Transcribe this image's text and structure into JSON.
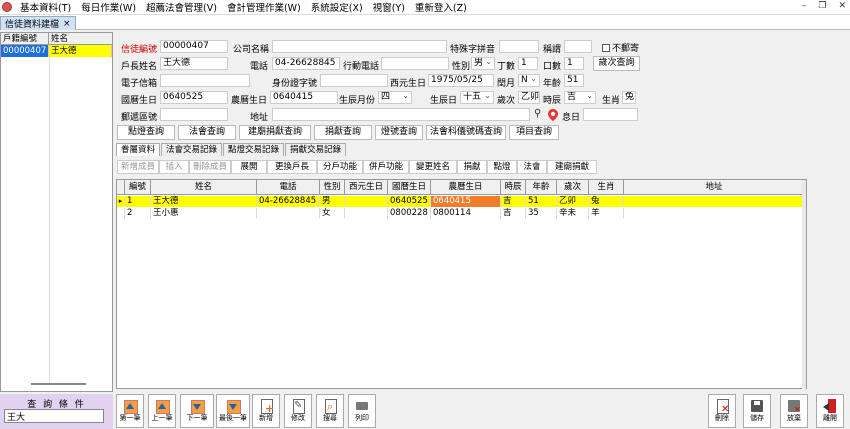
{
  "menu": {
    "items": [
      "基本資料(T)",
      "每日作業(W)",
      "超薦法會管理(V)",
      "會計管理作業(W)",
      "系統設定(X)",
      "視窗(Y)",
      "重新登入(Z)"
    ],
    "minimize": "–",
    "restore": "❐",
    "close": "✕"
  },
  "doc_tab": {
    "label": "信徒資料建檔",
    "close": "×"
  },
  "left_table": {
    "headers": [
      "戶籍編號",
      "姓名"
    ],
    "rows": [
      {
        "id": "00000407",
        "name": "王大德"
      }
    ]
  },
  "query": {
    "label": "查 詢 條 件",
    "value": "王大"
  },
  "form": {
    "member_no_label": "信徒編號",
    "member_no": "00000407",
    "company_label": "公司名稱",
    "company": "",
    "pinyin_label": "特殊字拼音",
    "pinyin": "",
    "title_label": "稱謂",
    "title": "",
    "no_mail_label": "不郵寄",
    "head_label": "戶長姓名",
    "head": "王大德",
    "phone_label": "電話",
    "phone": "04-26628845",
    "mobile_label": "行動電話",
    "mobile": "",
    "gender_label": "性別",
    "gender": "男",
    "ding_label": "丁數",
    "ding": "1",
    "kou_label": "口數",
    "kou": "1",
    "annual_btn": "歲次查詢",
    "email_label": "電子信箱",
    "email": "",
    "idno_label": "身份證字號",
    "idno": "",
    "west_birth_label": "西元生日",
    "west_birth": "1975/05/25",
    "leap_label": "閏月",
    "leap": "N",
    "age_label": "年齡",
    "age": "51",
    "roc_birth_label": "國曆生日",
    "roc_birth": "0640525",
    "lunar_birth_label": "農曆生日",
    "lunar_birth": "0640415",
    "birth_month_label": "生辰月份",
    "birth_month": "四",
    "birth_day_label": "生辰日",
    "birth_day": "十五",
    "annual_label": "歲次",
    "annual": "乙卯",
    "hour_label": "時辰",
    "hour": "吉",
    "zodiac_label": "生肖",
    "zodiac": "兔",
    "zip_label": "郵遞區號",
    "zip": "",
    "addr_label": "地址",
    "addr": "",
    "search_icon": "⚲",
    "remark_label": "息日",
    "remark": ""
  },
  "query_buttons": [
    "點燈查詢",
    "法會查詢",
    "建廟捐獻查詢",
    "捐獻查詢",
    "燈號查詢",
    "法會科儀號碼查詢",
    "項目查詢"
  ],
  "subtabs": [
    "眷屬資料",
    "法會交易記錄",
    "點燈交易記錄",
    "捐獻交易記錄"
  ],
  "toolbar2": [
    {
      "label": "新增成員",
      "disabled": true
    },
    {
      "label": "插入",
      "disabled": true
    },
    {
      "label": "刪除成員",
      "disabled": true
    },
    {
      "label": "展開",
      "disabled": false
    },
    {
      "label": "更換戶長",
      "disabled": false
    },
    {
      "label": "分戶功能",
      "disabled": false
    },
    {
      "label": "併戶功能",
      "disabled": false
    },
    {
      "label": "變更姓名",
      "disabled": false
    },
    {
      "label": "捐獻",
      "disabled": false
    },
    {
      "label": "點燈",
      "disabled": false
    },
    {
      "label": "法會",
      "disabled": false
    },
    {
      "label": "建廟捐獻",
      "disabled": false
    }
  ],
  "grid": {
    "headers": [
      "編號",
      "姓名",
      "電話",
      "性別",
      "西元生日",
      "國曆生日",
      "農曆生日",
      "時辰",
      "年齡",
      "歲次",
      "生肖",
      "地址"
    ],
    "rows": [
      [
        "1",
        "王大德",
        "04-26628845",
        "男",
        "",
        "0640525",
        "0640415",
        "吉",
        "51",
        "乙卯",
        "兔",
        ""
      ],
      [
        "2",
        "王小惠",
        "",
        "女",
        "",
        "0800228",
        "0800114",
        "吉",
        "35",
        "辛未",
        "羊",
        ""
      ]
    ]
  },
  "bottom_buttons": [
    "第一筆",
    "上一筆",
    "下一筆",
    "最後一筆",
    "新增",
    "修改",
    "搜尋",
    "列印"
  ],
  "right_buttons": [
    "刪除",
    "儲存",
    "放棄",
    "離開"
  ]
}
